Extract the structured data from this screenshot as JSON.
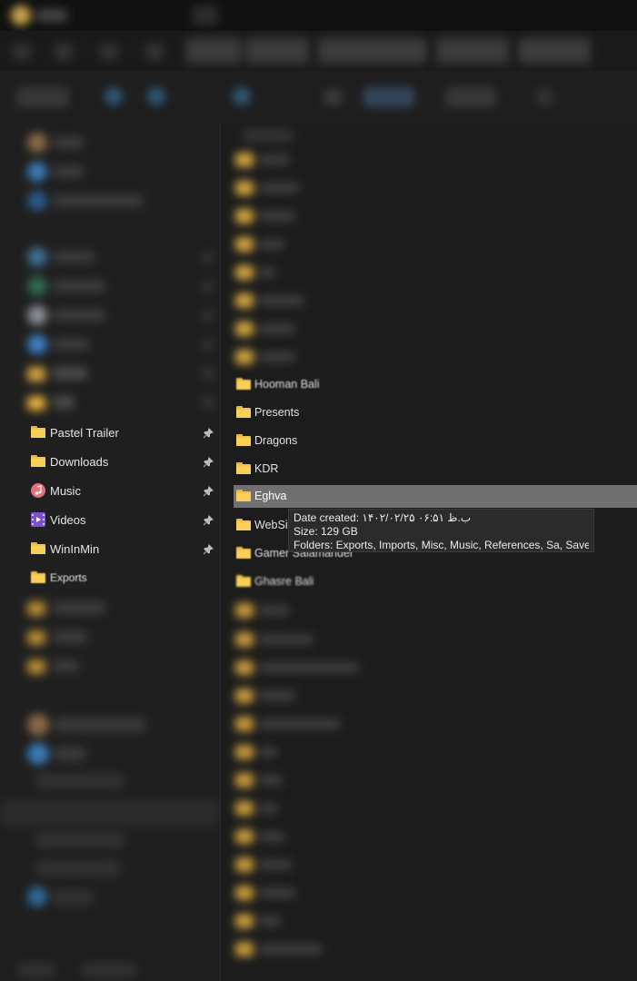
{
  "sidebar": {
    "items": [
      {
        "label": "Pastel Trailer",
        "icon": "folder-icon",
        "pinned": true
      },
      {
        "label": "Downloads",
        "icon": "folder-icon",
        "pinned": true
      },
      {
        "label": "Music",
        "icon": "music-icon",
        "pinned": true
      },
      {
        "label": "Videos",
        "icon": "videos-icon",
        "pinned": true
      },
      {
        "label": "WinInMin",
        "icon": "folder-icon",
        "pinned": true
      },
      {
        "label": "Exports",
        "icon": "folder-icon",
        "pinned": false
      }
    ]
  },
  "content": {
    "folders": [
      {
        "name": "Hooman Bali"
      },
      {
        "name": "Presents"
      },
      {
        "name": "Dragons"
      },
      {
        "name": "KDR"
      },
      {
        "name": "Eghva",
        "selected": true
      },
      {
        "name": "WebSit"
      },
      {
        "name": "Gamer Salamander"
      },
      {
        "name": "Ghasre Bali"
      }
    ]
  },
  "tooltip": {
    "date_created": "Date created: ۱۴۰۲/۰۲/۲۵ ب.ظ ۰۶:۵۱",
    "size": "Size: 129 GB",
    "folders": "Folders: Exports, Imports, Misc, Music, References, Sa, Save, ..."
  },
  "colors": {
    "background": "#1c1c1c",
    "sidebar": "#1f1f1f",
    "selection": "#707070",
    "folder": "#f3c24a",
    "music_icon": "#e0707a",
    "videos_icon": "#7d4fd1"
  }
}
